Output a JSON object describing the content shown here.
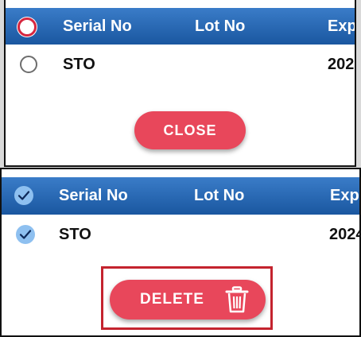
{
  "top_panel": {
    "columns": [
      "Serial No",
      "Lot No",
      "Exp"
    ],
    "row": {
      "serial": "STO",
      "expiry": "202"
    },
    "close_label": "CLOSE"
  },
  "bottom_panel": {
    "columns": [
      "Serial No",
      "Lot No",
      "Exp"
    ],
    "row": {
      "serial": "STO",
      "expiry": "2024"
    },
    "delete_label": "DELETE",
    "delete_icon": "trash-icon"
  },
  "colors": {
    "header_blue": "#1a57a0",
    "button_red": "#e8475b",
    "highlight_red": "#c4232e",
    "check_blue": "#8ec0f0"
  }
}
